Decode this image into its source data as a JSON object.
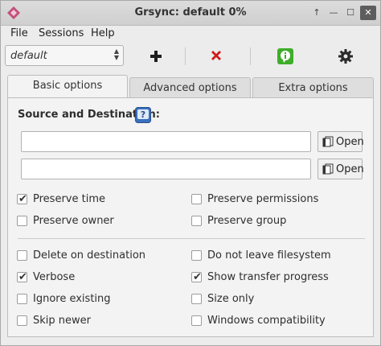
{
  "window": {
    "title": "Grsync: default 0%"
  },
  "menubar": {
    "items": [
      "File",
      "Sessions",
      "Help"
    ]
  },
  "toolbar": {
    "session_value": "default"
  },
  "tabs": [
    "Basic options",
    "Advanced options",
    "Extra options"
  ],
  "basic": {
    "section_label": "Source and Destination:",
    "source_value": "",
    "destination_value": "",
    "open_label": "Open",
    "options": [
      {
        "label": "Preserve time",
        "checked": true
      },
      {
        "label": "Preserve permissions",
        "checked": false
      },
      {
        "label": "Preserve owner",
        "checked": false
      },
      {
        "label": "Preserve group",
        "checked": false
      },
      {
        "label": "Delete on destination",
        "checked": false
      },
      {
        "label": "Do not leave filesystem",
        "checked": false
      },
      {
        "label": "Verbose",
        "checked": true
      },
      {
        "label": "Show transfer progress",
        "checked": true
      },
      {
        "label": "Ignore existing",
        "checked": false
      },
      {
        "label": "Size only",
        "checked": false
      },
      {
        "label": "Skip newer",
        "checked": false
      },
      {
        "label": "Windows compatibility",
        "checked": false
      }
    ]
  },
  "icons": {
    "add": "plus-icon",
    "delete": "red-x-icon",
    "execute": "green-info-icon",
    "preferences": "gear-icon"
  },
  "colors": {
    "accent_green": "#3fae2a",
    "delete_red": "#d11a1a",
    "help_blue": "#3a6fbf",
    "app_pink": "#c2507a"
  }
}
